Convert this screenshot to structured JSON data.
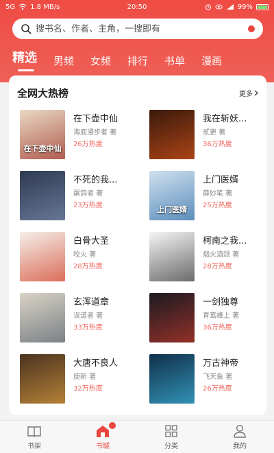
{
  "status_bar": {
    "signal": "5G",
    "speed": "1.8 MB/s",
    "time": "20:50",
    "battery": "99%",
    "battery_level": 0.99
  },
  "search": {
    "placeholder": "搜书名、作者、主角，一搜即有"
  },
  "tabs": [
    {
      "label": "精选",
      "active": true
    },
    {
      "label": "男频"
    },
    {
      "label": "女频"
    },
    {
      "label": "排行"
    },
    {
      "label": "书单"
    },
    {
      "label": "漫画"
    }
  ],
  "section": {
    "title": "全网大热榜",
    "more_label": "更多"
  },
  "books": [
    {
      "title": "在下壶中仙",
      "author": "海底漫步者 著",
      "heat": "26万热度",
      "cover_text": "在下壶中仙",
      "cover_color": "#e9d9c4",
      "cover_accent": "#9a2a20"
    },
    {
      "title": "我在斩妖...",
      "author": "贰更 著",
      "heat": "36万热度",
      "cover_text": "",
      "cover_color": "#3a1a0c",
      "cover_accent": "#d8541a"
    },
    {
      "title": "不死的我...",
      "author": "屠鸽者 著",
      "heat": "23万热度",
      "cover_text": "",
      "cover_color": "#2f3a52",
      "cover_accent": "#7b8fb0"
    },
    {
      "title": "上门医婿",
      "author": "薛妙笔 著",
      "heat": "25万热度",
      "cover_text": "上门医婿",
      "cover_color": "#cfe0ee",
      "cover_accent": "#2e6da8"
    },
    {
      "title": "白骨大圣",
      "author": "咬火 著",
      "heat": "28万热度",
      "cover_text": "",
      "cover_color": "#f4efe8",
      "cover_accent": "#d23a22"
    },
    {
      "title": "柯南之我...",
      "author": "烟火酒颂 著",
      "heat": "28万热度",
      "cover_text": "",
      "cover_color": "#f5f5f5",
      "cover_accent": "#333333"
    },
    {
      "title": "玄浑道章",
      "author": "误道者 著",
      "heat": "33万热度",
      "cover_text": "",
      "cover_color": "#d9d3c6",
      "cover_accent": "#55606c"
    },
    {
      "title": "一剑独尊",
      "author": "青鸾峰上 著",
      "heat": "36万热度",
      "cover_text": "",
      "cover_color": "#1c1a22",
      "cover_accent": "#c23a2a"
    },
    {
      "title": "大唐不良人",
      "author": "庚新 著",
      "heat": "32万热度",
      "cover_text": "",
      "cover_color": "#4a3320",
      "cover_accent": "#e0a040"
    },
    {
      "title": "万古神帝",
      "author": "飞天鱼 著",
      "heat": "26万热度",
      "cover_text": "",
      "cover_color": "#10304a",
      "cover_accent": "#3fb8e0"
    }
  ],
  "bottom_nav": [
    {
      "label": "书架",
      "icon": "book-open-icon"
    },
    {
      "label": "书城",
      "icon": "home-icon",
      "active": true
    },
    {
      "label": "分类",
      "icon": "grid-icon"
    },
    {
      "label": "我的",
      "icon": "user-icon"
    }
  ],
  "colors": {
    "accent": "#e8463e",
    "heat": "#f0635a"
  }
}
